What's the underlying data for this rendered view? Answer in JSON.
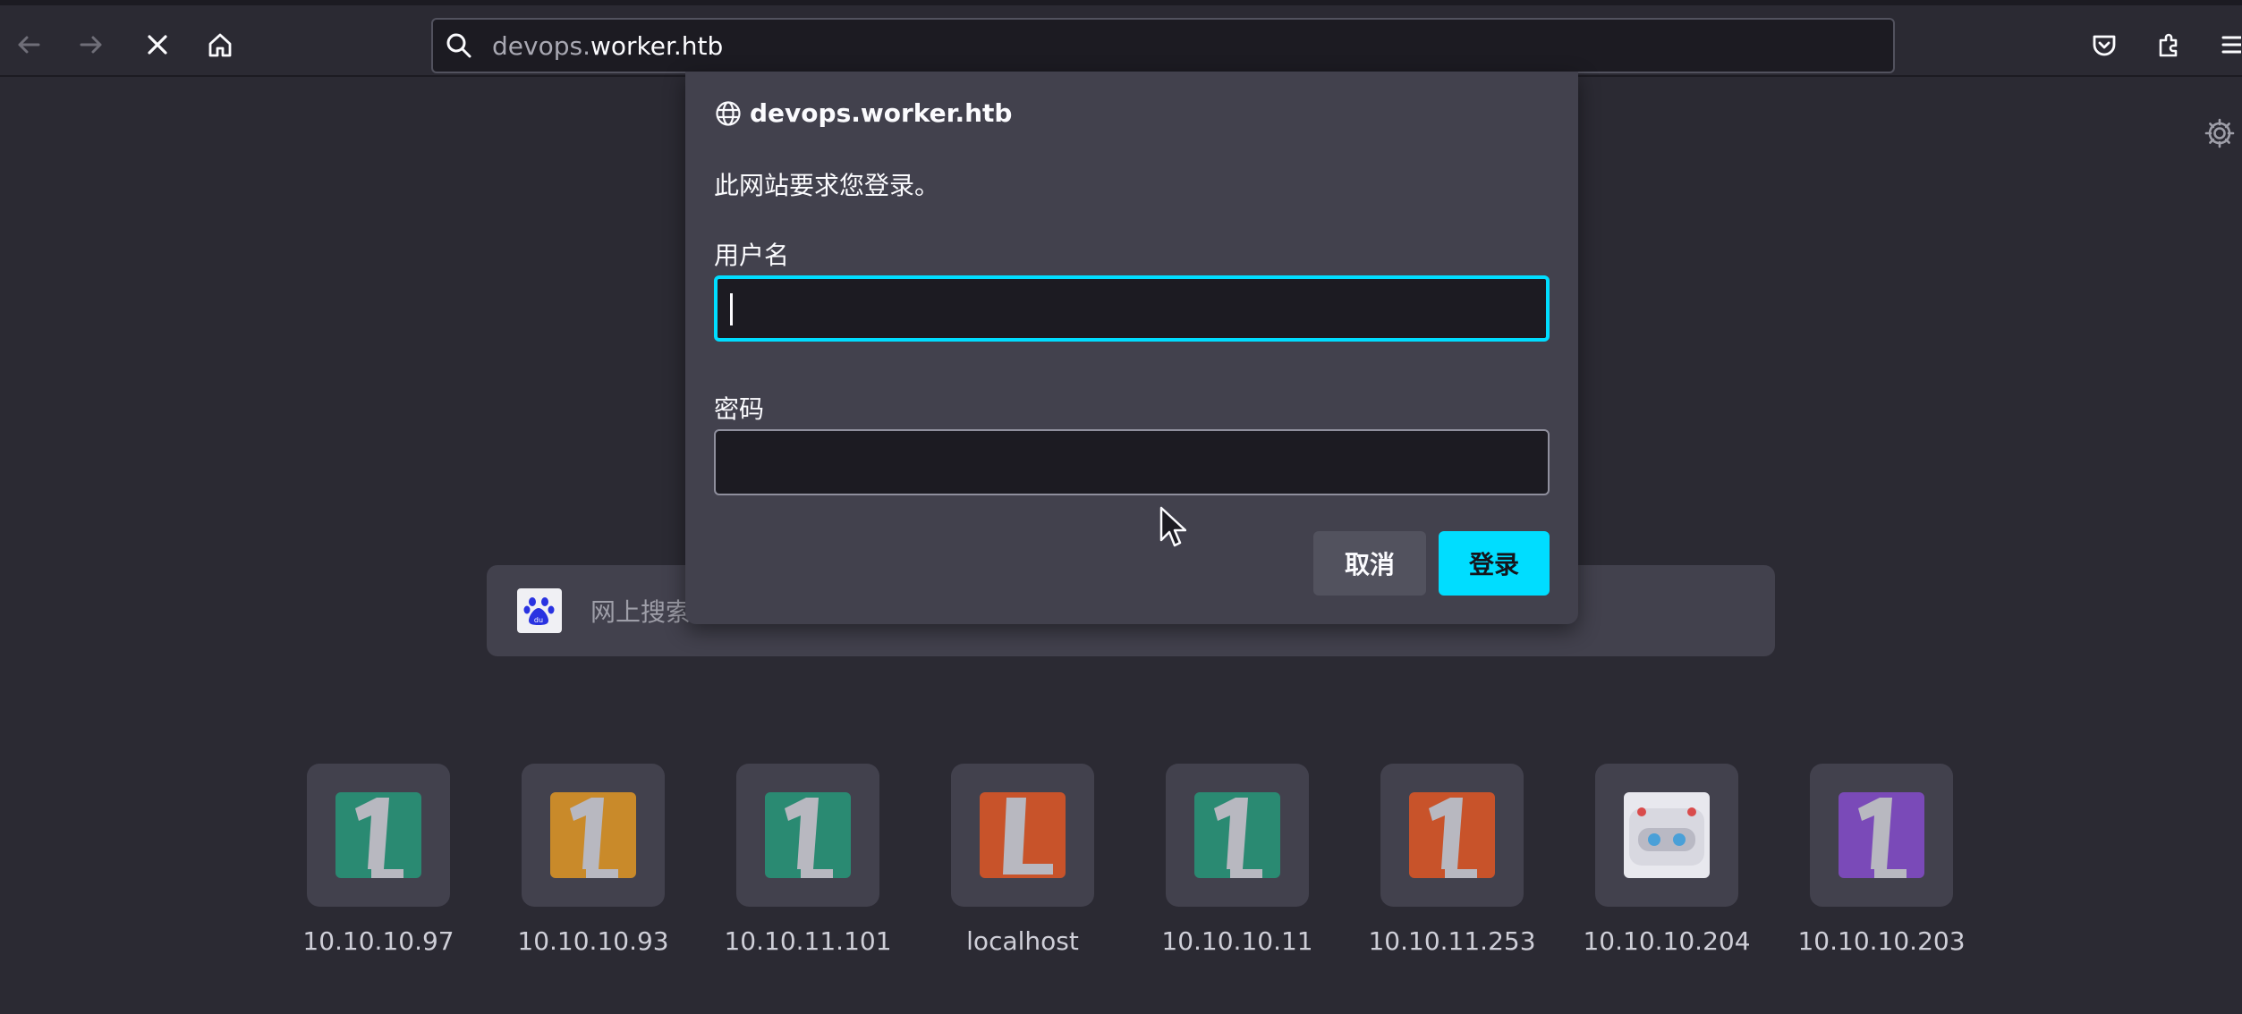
{
  "browser": {
    "url_prefix": "devops.",
    "url_host": "worker.htb",
    "icons": [
      "back-arrow-icon",
      "forward-arrow-icon",
      "stop-loading-icon",
      "home-icon",
      "search-icon",
      "pocket-icon",
      "extensions-icon",
      "menu-icon",
      "gear-icon"
    ]
  },
  "newtab": {
    "search_placeholder": "网上搜索",
    "search_engine_icon": "baidu-paw-icon",
    "shortcuts": [
      {
        "label": "10.10.10.97",
        "color": "#2a8a72",
        "glyph": "1"
      },
      {
        "label": "10.10.10.93",
        "color": "#c98a2a",
        "glyph": "1"
      },
      {
        "label": "10.10.11.101",
        "color": "#2a8a72",
        "glyph": "1"
      },
      {
        "label": "localhost",
        "color": "#c8532a",
        "glyph": "L"
      },
      {
        "label": "10.10.10.11",
        "color": "#2a8a72",
        "glyph": "1"
      },
      {
        "label": "10.10.11.253",
        "color": "#c8532a",
        "glyph": "1"
      },
      {
        "label": "10.10.10.204",
        "color": "#e8e8ee",
        "glyph": "robot"
      },
      {
        "label": "10.10.10.203",
        "color": "#7a4ab8",
        "glyph": "1"
      }
    ]
  },
  "auth_dialog": {
    "host": "devops.worker.htb",
    "message": "此网站要求您登录。",
    "username_label": "用户名",
    "password_label": "密码",
    "cancel_label": "取消",
    "login_label": "登录",
    "accent": "#00ddff"
  }
}
